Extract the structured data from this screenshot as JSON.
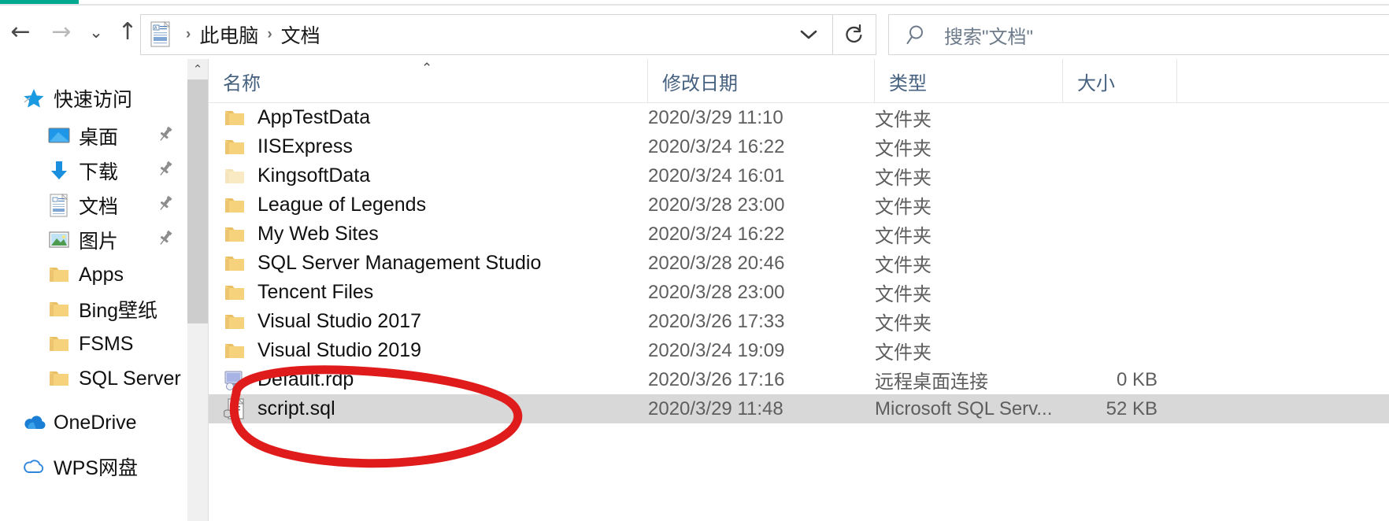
{
  "window": {
    "accent_color": "#00a98f"
  },
  "toolbar": {
    "back_label": "←",
    "forward_label": "→",
    "recent_label": "⌄",
    "up_label": "↑",
    "back_name": "后退",
    "forward_name": "前进",
    "recent_name": "最近浏览的位置",
    "up_name": "上移到上一级"
  },
  "address": {
    "icon": "documents-folder-icon",
    "crumbs": [
      "此电脑",
      "文档"
    ],
    "separator": "›",
    "dropdown_label": "⌄",
    "refresh_label": "↻"
  },
  "search": {
    "icon": "search-icon",
    "placeholder": "搜索\"文档\"",
    "value": ""
  },
  "sidebar": {
    "scroll": {
      "arrow_up": "⌃"
    },
    "items": [
      {
        "label": "快速访问",
        "icon": "star-icon",
        "level": 0,
        "pinned": false
      },
      {
        "label": "桌面",
        "icon": "desktop-icon",
        "level": 1,
        "pinned": true
      },
      {
        "label": "下载",
        "icon": "download-icon",
        "level": 1,
        "pinned": true
      },
      {
        "label": "文档",
        "icon": "document-icon",
        "level": 1,
        "pinned": true
      },
      {
        "label": "图片",
        "icon": "pictures-icon",
        "level": 1,
        "pinned": true
      },
      {
        "label": "Apps",
        "icon": "folder-icon",
        "level": 1,
        "pinned": false
      },
      {
        "label": "Bing壁纸",
        "icon": "folder-icon",
        "level": 1,
        "pinned": false
      },
      {
        "label": "FSMS",
        "icon": "folder-icon",
        "level": 1,
        "pinned": false
      },
      {
        "label": "SQL Server Mar",
        "icon": "folder-icon",
        "level": 1,
        "pinned": false
      },
      {
        "label": "OneDrive",
        "icon": "onedrive-icon",
        "level": 0,
        "pinned": false
      },
      {
        "label": "WPS网盘",
        "icon": "wps-cloud-icon",
        "level": 0,
        "pinned": false
      }
    ]
  },
  "filelist": {
    "columns": [
      {
        "key": "name",
        "label": "名称",
        "sorted": true,
        "sort_caret": "⌃"
      },
      {
        "key": "date",
        "label": "修改日期",
        "sorted": false
      },
      {
        "key": "type",
        "label": "类型",
        "sorted": false
      },
      {
        "key": "size",
        "label": "大小",
        "sorted": false
      }
    ],
    "rows": [
      {
        "name": "AppTestData",
        "date": "2020/3/29 11:10",
        "type": "文件夹",
        "size": "",
        "icon": "folder-icon",
        "selected": false,
        "dim": false
      },
      {
        "name": "IISExpress",
        "date": "2020/3/24 16:22",
        "type": "文件夹",
        "size": "",
        "icon": "folder-icon",
        "selected": false,
        "dim": false
      },
      {
        "name": "KingsoftData",
        "date": "2020/3/24 16:01",
        "type": "文件夹",
        "size": "",
        "icon": "folder-icon",
        "selected": false,
        "dim": true
      },
      {
        "name": "League of Legends",
        "date": "2020/3/28 23:00",
        "type": "文件夹",
        "size": "",
        "icon": "folder-icon",
        "selected": false,
        "dim": false
      },
      {
        "name": "My Web Sites",
        "date": "2020/3/24 16:22",
        "type": "文件夹",
        "size": "",
        "icon": "folder-icon",
        "selected": false,
        "dim": false
      },
      {
        "name": "SQL Server Management Studio",
        "date": "2020/3/28 20:46",
        "type": "文件夹",
        "size": "",
        "icon": "folder-icon",
        "selected": false,
        "dim": false
      },
      {
        "name": "Tencent Files",
        "date": "2020/3/28 23:00",
        "type": "文件夹",
        "size": "",
        "icon": "folder-icon",
        "selected": false,
        "dim": false
      },
      {
        "name": "Visual Studio 2017",
        "date": "2020/3/26 17:33",
        "type": "文件夹",
        "size": "",
        "icon": "folder-icon",
        "selected": false,
        "dim": false
      },
      {
        "name": "Visual Studio 2019",
        "date": "2020/3/24 19:09",
        "type": "文件夹",
        "size": "",
        "icon": "folder-icon",
        "selected": false,
        "dim": false
      },
      {
        "name": "Default.rdp",
        "date": "2020/3/26 17:16",
        "type": "远程桌面连接",
        "size": "0 KB",
        "icon": "rdp-icon",
        "selected": false,
        "dim": false
      },
      {
        "name": "script.sql",
        "date": "2020/3/29 11:48",
        "type": "Microsoft SQL Serv...",
        "size": "52 KB",
        "icon": "sql-file-icon",
        "selected": true,
        "dim": false
      }
    ]
  },
  "annotation": {
    "shape": "red-ellipse-highlight",
    "color": "#e01b1b",
    "targets": "script.sql"
  }
}
